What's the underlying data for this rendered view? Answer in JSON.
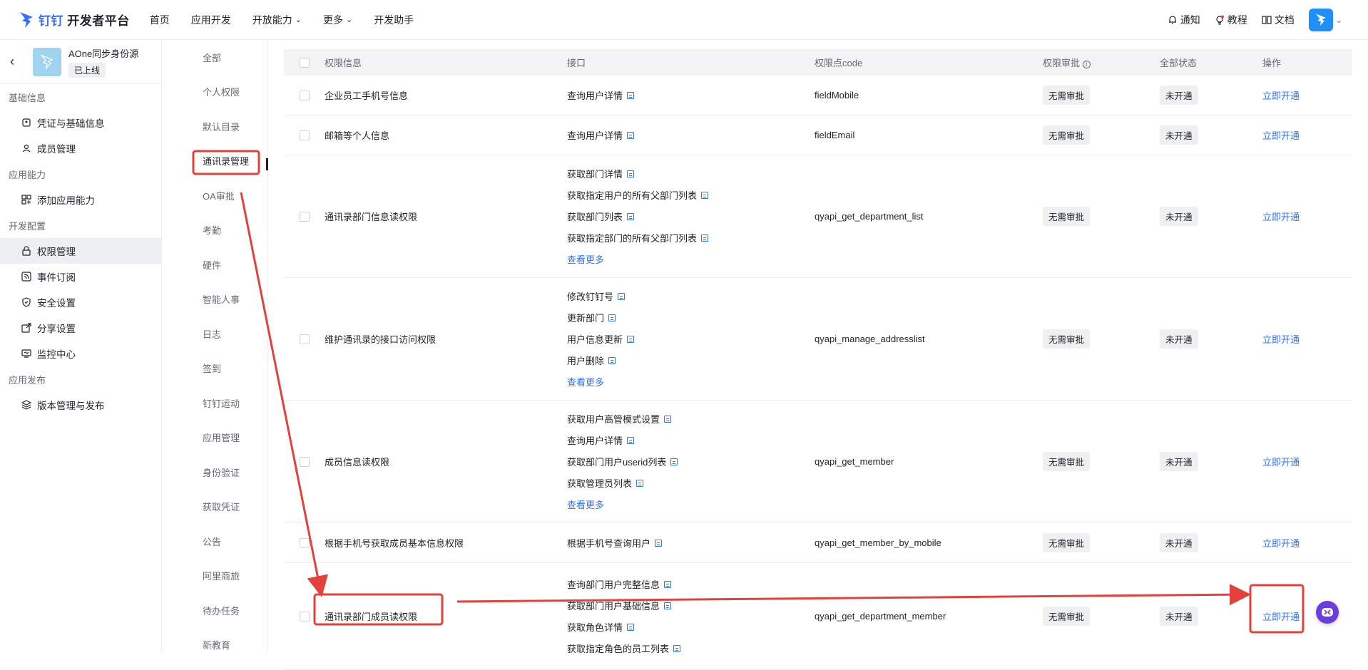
{
  "topbar": {
    "logo_brand": "钉钉",
    "logo_title": "开发者平台",
    "nav": [
      {
        "label": "首页",
        "dropdown": false
      },
      {
        "label": "应用开发",
        "dropdown": false
      },
      {
        "label": "开放能力",
        "dropdown": true
      },
      {
        "label": "更多",
        "dropdown": true
      },
      {
        "label": "开发助手",
        "dropdown": false
      }
    ],
    "notify": "通知",
    "tutorial": "教程",
    "docs": "文档"
  },
  "app": {
    "name": "AOne同步身份源",
    "status": "已上线"
  },
  "sidebar": {
    "sections": [
      {
        "title": "基础信息",
        "items": [
          {
            "label": "凭证与基础信息",
            "icon": "credential-icon"
          },
          {
            "label": "成员管理",
            "icon": "member-icon"
          }
        ]
      },
      {
        "title": "应用能力",
        "items": [
          {
            "label": "添加应用能力",
            "icon": "grid-icon"
          }
        ]
      },
      {
        "title": "开发配置",
        "items": [
          {
            "label": "权限管理",
            "icon": "lock-icon",
            "active": true
          },
          {
            "label": "事件订阅",
            "icon": "rss-icon"
          },
          {
            "label": "安全设置",
            "icon": "shield-icon"
          },
          {
            "label": "分享设置",
            "icon": "share-icon"
          },
          {
            "label": "监控中心",
            "icon": "monitor-icon"
          }
        ]
      },
      {
        "title": "应用发布",
        "items": [
          {
            "label": "版本管理与发布",
            "icon": "layers-icon"
          }
        ]
      }
    ]
  },
  "categories": [
    "全部",
    "个人权限",
    "默认目录",
    "通讯录管理",
    "OA审批",
    "考勤",
    "硬件",
    "智能人事",
    "日志",
    "签到",
    "钉钉运动",
    "应用管理",
    "身份验证",
    "获取凭证",
    "公告",
    "阿里商旅",
    "待办任务",
    "新教育"
  ],
  "active_category": "通讯录管理",
  "table": {
    "headers": {
      "name": "权限信息",
      "api": "接口",
      "code": "权限点code",
      "review": "权限审批",
      "state": "全部状态",
      "op": "操作"
    },
    "rows": [
      {
        "name": "企业员工手机号信息",
        "apis": [
          "查询用户详情"
        ],
        "more": "",
        "code": "fieldMobile",
        "review": "无需审批",
        "state": "未开通",
        "op": "立即开通"
      },
      {
        "name": "邮箱等个人信息",
        "apis": [
          "查询用户详情"
        ],
        "more": "",
        "code": "fieldEmail",
        "review": "无需审批",
        "state": "未开通",
        "op": "立即开通"
      },
      {
        "name": "通讯录部门信息读权限",
        "apis": [
          "获取部门详情",
          "获取指定用户的所有父部门列表",
          "获取部门列表",
          "获取指定部门的所有父部门列表"
        ],
        "more": "查看更多",
        "code": "qyapi_get_department_list",
        "review": "无需审批",
        "state": "未开通",
        "op": "立即开通"
      },
      {
        "name": "维护通讯录的接口访问权限",
        "apis": [
          "修改钉钉号",
          "更新部门",
          "用户信息更新",
          "用户删除"
        ],
        "more": "查看更多",
        "code": "qyapi_manage_addresslist",
        "review": "无需审批",
        "state": "未开通",
        "op": "立即开通"
      },
      {
        "name": "成员信息读权限",
        "apis": [
          "获取用户高管模式设置",
          "查询用户详情",
          "获取部门用户userid列表",
          "获取管理员列表"
        ],
        "more": "查看更多",
        "code": "qyapi_get_member",
        "review": "无需审批",
        "state": "未开通",
        "op": "立即开通"
      },
      {
        "name": "根据手机号获取成员基本信息权限",
        "apis": [
          "根据手机号查询用户"
        ],
        "more": "",
        "code": "qyapi_get_member_by_mobile",
        "review": "无需审批",
        "state": "未开通",
        "op": "立即开通"
      },
      {
        "name": "通讯录部门成员读权限",
        "apis": [
          "查询部门用户完整信息",
          "获取部门用户基础信息",
          "获取角色详情",
          "获取指定角色的员工列表"
        ],
        "more": "",
        "code": "qyapi_get_department_member",
        "review": "无需审批",
        "state": "未开通",
        "op": "立即开通"
      }
    ]
  },
  "colors": {
    "accent": "#3370ff",
    "annotation": "#e5413c"
  }
}
